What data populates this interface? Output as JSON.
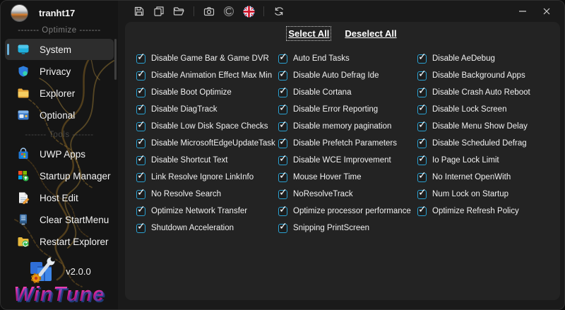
{
  "titlebar": {
    "icons": [
      "save",
      "save-copy",
      "open-folder",
      "screenshot",
      "theme",
      "language-uk-flag",
      "refresh"
    ],
    "window_controls": [
      "minimize",
      "close"
    ]
  },
  "sidebar": {
    "username": "tranht17",
    "sections": [
      {
        "divider": "------- Optimize -------",
        "items": [
          {
            "label": "System",
            "selected": true
          },
          {
            "label": "Privacy",
            "selected": false
          },
          {
            "label": "Explorer",
            "selected": false
          },
          {
            "label": "Optional",
            "selected": false
          }
        ]
      },
      {
        "divider": "------- Tools -------",
        "items": [
          {
            "label": "UWP Apps",
            "selected": false
          },
          {
            "label": "Startup Manager",
            "selected": false
          },
          {
            "label": "Host Edit",
            "selected": false
          },
          {
            "label": "Clear StartMenu",
            "selected": false
          },
          {
            "label": "Restart Explorer",
            "selected": false
          }
        ]
      }
    ],
    "version": "v2.0.0",
    "brand": "WinTune"
  },
  "main": {
    "select_all_label": "Select All",
    "deselect_all_label": "Deselect All",
    "columns": [
      [
        {
          "label": "Disable Game Bar & Game DVR",
          "checked": true
        },
        {
          "label": "Disable Animation Effect Max Min",
          "checked": true
        },
        {
          "label": "Disable Boot Optimize",
          "checked": true
        },
        {
          "label": "Disable DiagTrack",
          "checked": true
        },
        {
          "label": "Disable Low Disk Space Checks",
          "checked": true
        },
        {
          "label": "Disable MicrosoftEdgeUpdateTask",
          "checked": true
        },
        {
          "label": "Disable Shortcut Text",
          "checked": true
        },
        {
          "label": "Link Resolve Ignore LinkInfo",
          "checked": true
        },
        {
          "label": "No Resolve Search",
          "checked": true
        },
        {
          "label": "Optimize Network Transfer",
          "checked": true
        },
        {
          "label": "Shutdown Acceleration",
          "checked": true
        }
      ],
      [
        {
          "label": "Auto End Tasks",
          "checked": true
        },
        {
          "label": "Disable Auto Defrag Ide",
          "checked": true
        },
        {
          "label": "Disable Cortana",
          "checked": true
        },
        {
          "label": "Disable Error Reporting",
          "checked": true
        },
        {
          "label": "Disable memory pagination",
          "checked": true
        },
        {
          "label": "Disable Prefetch Parameters",
          "checked": true
        },
        {
          "label": "Disable WCE Improvement",
          "checked": true
        },
        {
          "label": "Mouse Hover Time",
          "checked": true
        },
        {
          "label": "NoResolveTrack",
          "checked": true
        },
        {
          "label": "Optimize processor performance",
          "checked": true
        },
        {
          "label": "Snipping PrintScreen",
          "checked": true
        }
      ],
      [
        {
          "label": "Disable AeDebug",
          "checked": true
        },
        {
          "label": "Disable Background Apps",
          "checked": true
        },
        {
          "label": "Disable Crash Auto Reboot",
          "checked": true
        },
        {
          "label": "Disable Lock Screen",
          "checked": true
        },
        {
          "label": "Disable Menu Show Delay",
          "checked": true
        },
        {
          "label": "Disable Scheduled Defrag",
          "checked": true
        },
        {
          "label": "Io Page Lock Limit",
          "checked": true
        },
        {
          "label": "No Internet OpenWith",
          "checked": true
        },
        {
          "label": "Num Lock on Startup",
          "checked": true
        },
        {
          "label": "Optimize Refresh Policy",
          "checked": true
        }
      ]
    ]
  },
  "colors": {
    "accent_blue": "#2aa1d2",
    "selection_pill": "#6ab0d8",
    "brand_pink": "#d6219c",
    "panel_bg": "#232323",
    "window_bg": "#1a1a1a"
  }
}
